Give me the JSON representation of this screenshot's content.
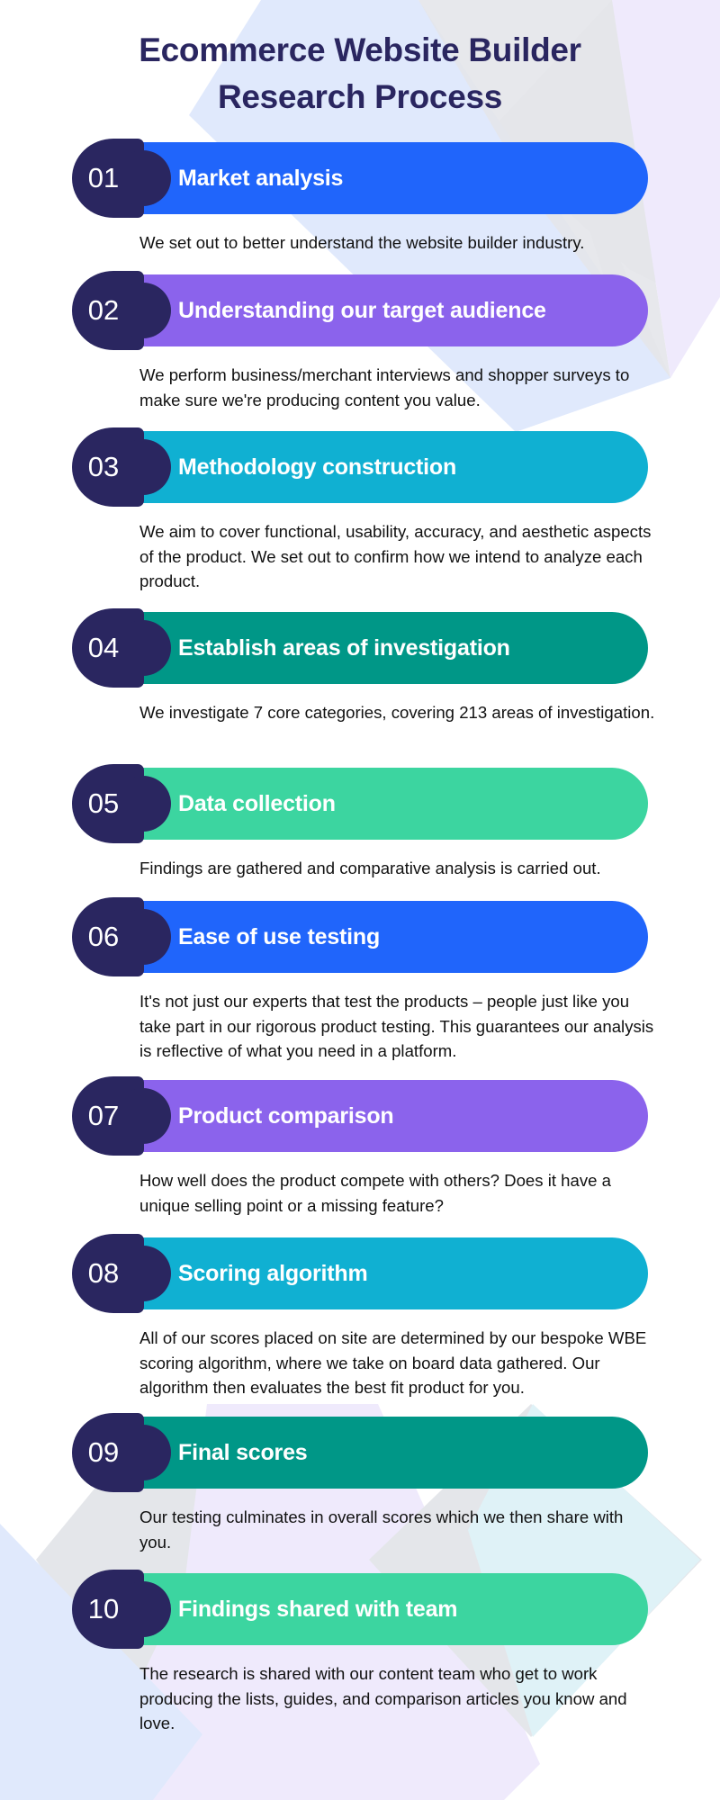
{
  "title": {
    "line1": "Ecommerce Website Builder",
    "line2": "Research Process"
  },
  "colors": {
    "navy": "#2a2660",
    "blue": "#2065fb",
    "purple": "#8b63ec",
    "cyan": "#10b0d2",
    "teal": "#009787",
    "green": "#3cd5a0"
  },
  "steps": [
    {
      "number": "01",
      "title": "Market analysis",
      "color": "#2065fb",
      "description": "We set out to better understand the website builder industry."
    },
    {
      "number": "02",
      "title": "Understanding our target audience",
      "color": "#8b63ec",
      "description": "We perform business/merchant interviews and shopper surveys to make sure we're producing content you value."
    },
    {
      "number": "03",
      "title": "Methodology construction",
      "color": "#10b0d2",
      "description": "We aim to cover functional, usability, accuracy, and aesthetic aspects of the product. We set out to confirm how we intend to analyze each product."
    },
    {
      "number": "04",
      "title": "Establish areas of investigation",
      "color": "#009787",
      "description": "We investigate 7 core categories, covering 213 areas of investigation."
    },
    {
      "number": "05",
      "title": "Data collection",
      "color": "#3cd5a0",
      "description": "Findings are gathered and comparative analysis is carried out."
    },
    {
      "number": "06",
      "title": "Ease of use testing",
      "color": "#2065fb",
      "description": "It's not just our experts that test the products – people just like you take part in our rigorous product testing. This guarantees our analysis is reflective of what you need in a platform."
    },
    {
      "number": "07",
      "title": "Product comparison",
      "color": "#8b63ec",
      "description": "How well does the product compete with others? Does it have a unique selling point or a missing feature?"
    },
    {
      "number": "08",
      "title": "Scoring algorithm",
      "color": "#10b0d2",
      "description": "All of our scores placed on site are determined by our bespoke WBE scoring algorithm, where we take on board data gathered. Our algorithm then evaluates the best fit product for you."
    },
    {
      "number": "09",
      "title": "Final scores",
      "color": "#009787",
      "description": "Our testing culminates in overall scores which we then share with you."
    },
    {
      "number": "10",
      "title": "Findings shared with team",
      "color": "#3cd5a0",
      "description": "The research is shared with our content team who get to work producing the lists, guides, and comparison articles you know and love."
    }
  ]
}
